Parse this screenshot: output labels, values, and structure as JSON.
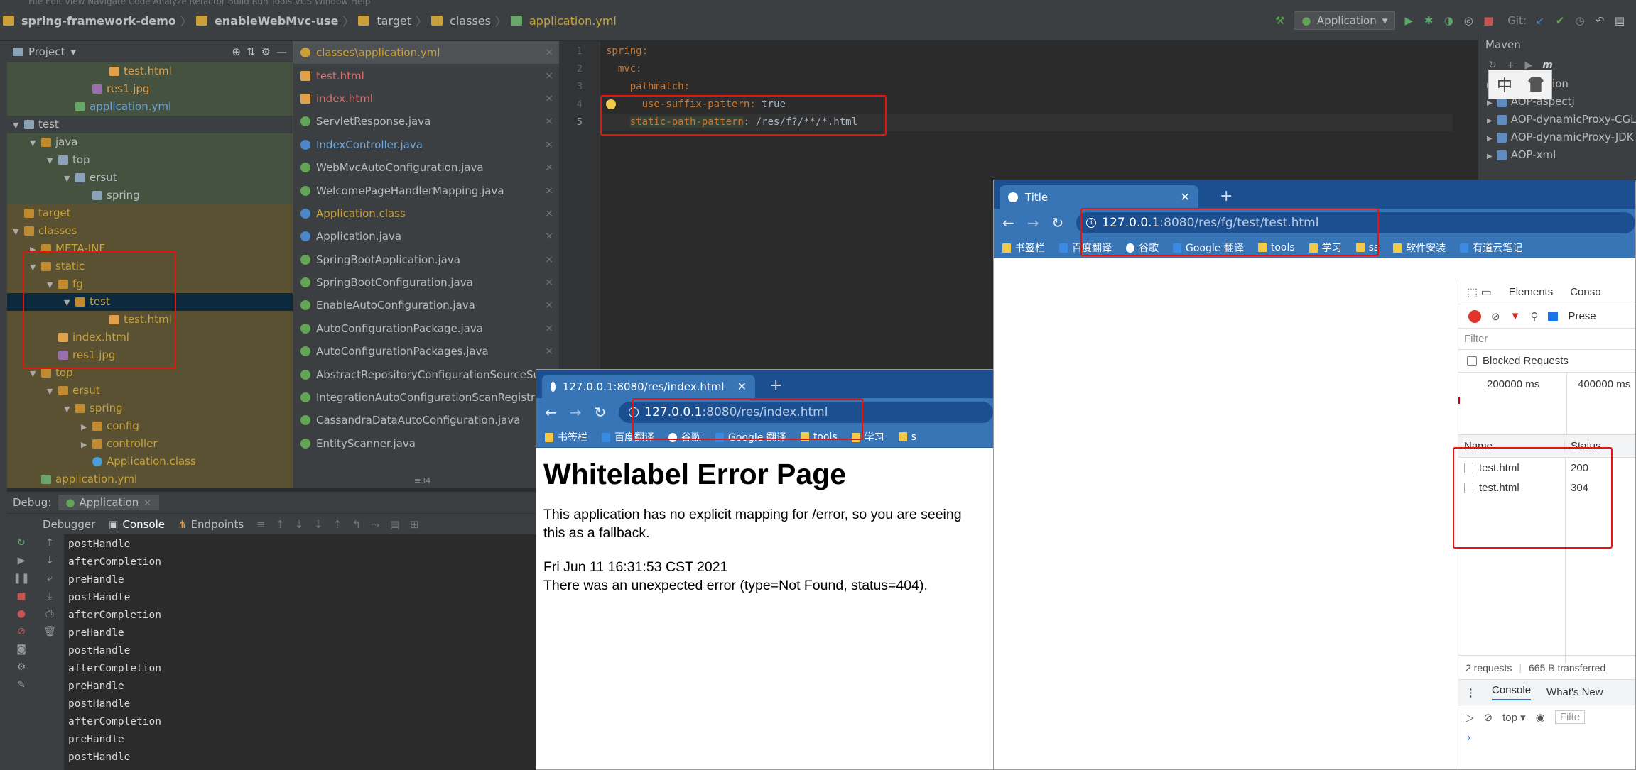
{
  "ide": {
    "breadcrumb": [
      "spring-framework-demo",
      "enableWebMvc-use",
      "target",
      "classes",
      "application.yml"
    ],
    "run_config": "Application",
    "vcs_label": "Git:"
  },
  "project_panel": {
    "title": "Project",
    "tree": [
      {
        "label": "test.html",
        "indent": 5,
        "icon": "file-html",
        "color": "#e2a04a",
        "row": "row-green"
      },
      {
        "label": "res1.jpg",
        "indent": 4,
        "icon": "file-img",
        "color": "#e2a04a",
        "row": "row-green"
      },
      {
        "label": "application.yml",
        "indent": 3,
        "icon": "file-yml",
        "color": "#6fa5d8",
        "row": "row-green"
      },
      {
        "label": "test",
        "indent": 0,
        "icon": "folder-blue",
        "color": "#bbbbbb",
        "row": "",
        "tw": "▼"
      },
      {
        "label": "java",
        "indent": 1,
        "icon": "folder",
        "color": "#bbbbbb",
        "row": "row-green",
        "tw": "▼"
      },
      {
        "label": "top",
        "indent": 2,
        "icon": "folder-blue",
        "color": "#bbbbbb",
        "row": "row-green",
        "tw": "▼"
      },
      {
        "label": "ersut",
        "indent": 3,
        "icon": "folder-blue",
        "color": "#bbbbbb",
        "row": "row-green",
        "tw": "▼"
      },
      {
        "label": "spring",
        "indent": 4,
        "icon": "folder-blue",
        "color": "#bbbbbb",
        "row": "row-green"
      },
      {
        "label": "target",
        "indent": 0,
        "icon": "folder",
        "color": "#c8a23a",
        "row": "row-olive"
      },
      {
        "label": "classes",
        "indent": 0,
        "icon": "folder",
        "color": "#c8a23a",
        "row": "row-olive",
        "tw": "▼"
      },
      {
        "label": "META-INF",
        "indent": 1,
        "icon": "folder",
        "color": "#c8a23a",
        "row": "row-olive",
        "tw": "▶"
      },
      {
        "label": "static",
        "indent": 1,
        "icon": "folder",
        "color": "#c8a23a",
        "row": "row-olive",
        "tw": "▼"
      },
      {
        "label": "fg",
        "indent": 2,
        "icon": "folder",
        "color": "#c8a23a",
        "row": "row-olive",
        "tw": "▼"
      },
      {
        "label": "test",
        "indent": 3,
        "icon": "folder",
        "color": "#c8a23a",
        "row": "row-sel",
        "tw": "▼"
      },
      {
        "label": "test.html",
        "indent": 5,
        "icon": "file-html",
        "color": "#c8a23a",
        "row": "row-olive"
      },
      {
        "label": "index.html",
        "indent": 2,
        "icon": "file-html",
        "color": "#c8a23a",
        "row": "row-olive"
      },
      {
        "label": "res1.jpg",
        "indent": 2,
        "icon": "file-img",
        "color": "#c8a23a",
        "row": "row-olive"
      },
      {
        "label": "top",
        "indent": 1,
        "icon": "folder",
        "color": "#c8a23a",
        "row": "row-olive",
        "tw": "▼"
      },
      {
        "label": "ersut",
        "indent": 2,
        "icon": "folder",
        "color": "#c8a23a",
        "row": "row-olive",
        "tw": "▼"
      },
      {
        "label": "spring",
        "indent": 3,
        "icon": "folder",
        "color": "#c8a23a",
        "row": "row-olive",
        "tw": "▼"
      },
      {
        "label": "config",
        "indent": 4,
        "icon": "folder",
        "color": "#c8a23a",
        "row": "row-olive",
        "tw": "▶"
      },
      {
        "label": "controller",
        "indent": 4,
        "icon": "folder",
        "color": "#c8a23a",
        "row": "row-olive",
        "tw": "▶"
      },
      {
        "label": "Application.class",
        "indent": 4,
        "icon": "file-class",
        "color": "#c8a23a",
        "row": "row-olive"
      },
      {
        "label": "application.yml",
        "indent": 1,
        "icon": "file-yml",
        "color": "#c8a23a",
        "row": "row-olive"
      }
    ]
  },
  "tabs_panel": {
    "files": [
      {
        "label": "classes\\application.yml",
        "icon": "ci-yellow",
        "cls": "yellowish active"
      },
      {
        "label": "test.html",
        "icon": "ci-orange",
        "cls": "red"
      },
      {
        "label": "index.html",
        "icon": "ci-orange",
        "cls": "red"
      },
      {
        "label": "ServletResponse.java",
        "icon": "ci-green",
        "cls": ""
      },
      {
        "label": "IndexController.java",
        "icon": "ci-blue",
        "cls": "blueish"
      },
      {
        "label": "WebMvcAutoConfiguration.java",
        "icon": "ci-green",
        "cls": ""
      },
      {
        "label": "WelcomePageHandlerMapping.java",
        "icon": "ci-green",
        "cls": ""
      },
      {
        "label": "Application.class",
        "icon": "ci-blue",
        "cls": "yellowish"
      },
      {
        "label": "Application.java",
        "icon": "ci-blue",
        "cls": ""
      },
      {
        "label": "SpringBootApplication.java",
        "icon": "ci-green",
        "cls": ""
      },
      {
        "label": "SpringBootConfiguration.java",
        "icon": "ci-green",
        "cls": ""
      },
      {
        "label": "EnableAutoConfiguration.java",
        "icon": "ci-green",
        "cls": ""
      },
      {
        "label": "AutoConfigurationPackage.java",
        "icon": "ci-green",
        "cls": ""
      },
      {
        "label": "AutoConfigurationPackages.java",
        "icon": "ci-green",
        "cls": ""
      },
      {
        "label": "AbstractRepositoryConfigurationSourceSu",
        "icon": "ci-green",
        "cls": ""
      },
      {
        "label": "IntegrationAutoConfigurationScanRegistra",
        "icon": "ci-green",
        "cls": ""
      },
      {
        "label": "CassandraDataAutoConfiguration.java",
        "icon": "ci-green",
        "cls": ""
      },
      {
        "label": "EntityScanner.java",
        "icon": "ci-green",
        "cls": ""
      }
    ],
    "more": "≡34"
  },
  "editor": {
    "line_numbers": [
      "1",
      "2",
      "3",
      "4",
      "5"
    ],
    "lines": [
      {
        "key": "spring:",
        "value": "",
        "indent": 0
      },
      {
        "key": "mvc:",
        "value": "",
        "indent": 2
      },
      {
        "key": "pathmatch:",
        "value": "",
        "indent": 4
      },
      {
        "key": "use-suffix-pattern:",
        "value": " true",
        "indent": 6
      },
      {
        "key": "static-path-pattern",
        "value": ": /res/f?/**/*.html",
        "indent": 4
      }
    ]
  },
  "maven": {
    "title": "Maven",
    "items": [
      "annotation",
      "AOP-aspectj",
      "AOP-dynamicProxy-CGL",
      "AOP-dynamicProxy-JDK",
      "AOP-xml"
    ]
  },
  "ime": {
    "char1": "中",
    "char2": "👕"
  },
  "debug": {
    "label": "Debug:",
    "config": "Application",
    "tabs": [
      "Debugger",
      "Console",
      "Endpoints"
    ],
    "console_lines": [
      "postHandle",
      "afterCompletion",
      "preHandle",
      "postHandle",
      "afterCompletion",
      "preHandle",
      "postHandle",
      "afterCompletion",
      "preHandle",
      "postHandle",
      "afterCompletion",
      "preHandle",
      "postHandle"
    ]
  },
  "browser_front": {
    "tab_title": "127.0.0.1:8080/res/index.html",
    "url_host": "127.0.0.1",
    "url_rest": ":8080/res/index.html",
    "bookmarks": [
      "书签栏",
      "百度翻译",
      "谷歌",
      "Google 翻译",
      "tools",
      "学习",
      "s"
    ],
    "page": {
      "heading": "Whitelabel Error Page",
      "para1": "This application has no explicit mapping for /error, so you are seeing this as a fallback.",
      "date": "Fri Jun 11 16:31:53 CST 2021",
      "error": "There was an unexpected error (type=Not Found, status=404)."
    }
  },
  "browser_back": {
    "tab_title": "Title",
    "url_host": "127.0.0.1",
    "url_rest": ":8080/res/fg/test/test.html",
    "bookmarks": [
      "书签栏",
      "百度翻译",
      "谷歌",
      "Google 翻译",
      "tools",
      "学习",
      "ss",
      "软件安装",
      "有道云笔记"
    ]
  },
  "devtools": {
    "tabs": [
      "Elements",
      "Conso"
    ],
    "preserve": "Prese",
    "filter_placeholder": "Filter",
    "blocked": "Blocked Requests",
    "timeline_ticks": [
      "200000 ms",
      "400000 ms"
    ],
    "columns": [
      "Name",
      "Status"
    ],
    "rows": [
      {
        "name": "test.html",
        "status": "200"
      },
      {
        "name": "test.html",
        "status": "304"
      }
    ],
    "summary_requests": "2 requests",
    "summary_transferred": "665 B transferred",
    "drawer_tabs": [
      "Console",
      "What's New"
    ],
    "context": "top",
    "console_filter": "Filte",
    "prompt": "›"
  }
}
